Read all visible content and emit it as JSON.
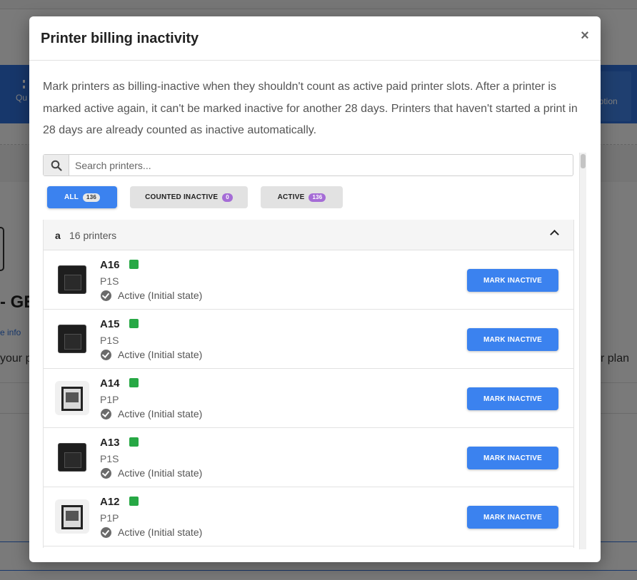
{
  "background": {
    "nav_left_label": "Qu",
    "nav_right_label": "ription",
    "heading_fragment": "- GE",
    "info_fragment": "e info",
    "text_left_fragment": "your pl",
    "text_right_fragment": "r plan"
  },
  "modal": {
    "title": "Printer billing inactivity",
    "close_label": "×",
    "description": "Mark printers as billing-inactive when they shouldn't count as active paid printer slots. After a printer is marked active again, it can't be marked inactive for another 28 days. Printers that haven't started a print in 28 days are already counted as inactive automatically."
  },
  "search": {
    "placeholder": "Search printers..."
  },
  "filters": [
    {
      "label": "ALL",
      "count": "136"
    },
    {
      "label": "COUNTED INACTIVE",
      "count": "0"
    },
    {
      "label": "ACTIVE",
      "count": "136"
    }
  ],
  "group": {
    "letter": "a",
    "count_label": "16 printers"
  },
  "printers": [
    {
      "name": "A16",
      "model": "P1S",
      "state": "Active (Initial state)",
      "action": "MARK INACTIVE"
    },
    {
      "name": "A15",
      "model": "P1S",
      "state": "Active (Initial state)",
      "action": "MARK INACTIVE"
    },
    {
      "name": "A14",
      "model": "P1P",
      "state": "Active (Initial state)",
      "action": "MARK INACTIVE"
    },
    {
      "name": "A13",
      "model": "P1S",
      "state": "Active (Initial state)",
      "action": "MARK INACTIVE"
    },
    {
      "name": "A12",
      "model": "P1P",
      "state": "Active (Initial state)",
      "action": "MARK INACTIVE"
    }
  ],
  "colors": {
    "primary": "#3b82ef",
    "status_green": "#27a845",
    "badge_purple": "#a56cd6"
  }
}
